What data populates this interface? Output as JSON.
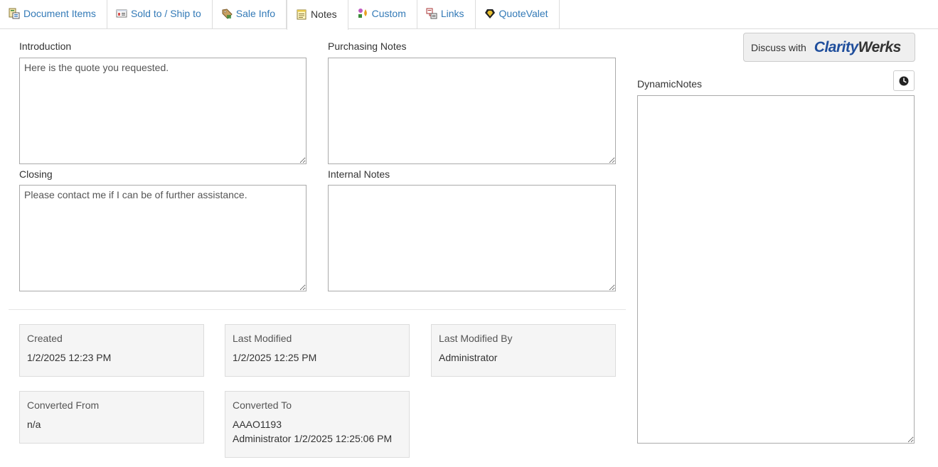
{
  "tabs": [
    {
      "label": "Document Items",
      "icon": "document-items-icon",
      "active": false
    },
    {
      "label": "Sold to / Ship to",
      "icon": "address-card-icon",
      "active": false
    },
    {
      "label": "Sale Info",
      "icon": "sale-tag-icon",
      "active": false
    },
    {
      "label": "Notes",
      "icon": "notes-icon",
      "active": true
    },
    {
      "label": "Custom",
      "icon": "custom-shapes-icon",
      "active": false
    },
    {
      "label": "Links",
      "icon": "links-icon",
      "active": false
    },
    {
      "label": "QuoteValet",
      "icon": "quotevalet-icon",
      "active": false
    }
  ],
  "notes": {
    "introduction": {
      "label": "Introduction",
      "value": "Here is the quote you requested."
    },
    "purchasing": {
      "label": "Purchasing Notes",
      "value": ""
    },
    "closing": {
      "label": "Closing",
      "value": "Please contact me if I can be of further assistance."
    },
    "internal": {
      "label": "Internal Notes",
      "value": ""
    }
  },
  "info": {
    "created": {
      "label": "Created",
      "value": "1/2/2025 12:23 PM"
    },
    "last_modified": {
      "label": "Last Modified",
      "value": "1/2/2025 12:25 PM"
    },
    "last_modified_by": {
      "label": "Last Modified By",
      "value": "Administrator"
    },
    "converted_from": {
      "label": "Converted From",
      "value": "n/a"
    },
    "converted_to": {
      "label": "Converted To",
      "value_line1": "AAAO1193",
      "value_line2": "Administrator 1/2/2025 12:25:06 PM"
    }
  },
  "discuss": {
    "label": "Discuss with",
    "brand_part1": "Clarity",
    "brand_part2": "Werks"
  },
  "dynamic_notes": {
    "label": "DynamicNotes",
    "value": "",
    "history_icon": "clock-icon"
  },
  "colors": {
    "link": "#337ab7",
    "brand_blue": "#1f4e9c",
    "panel_bg": "#f5f5f5"
  }
}
